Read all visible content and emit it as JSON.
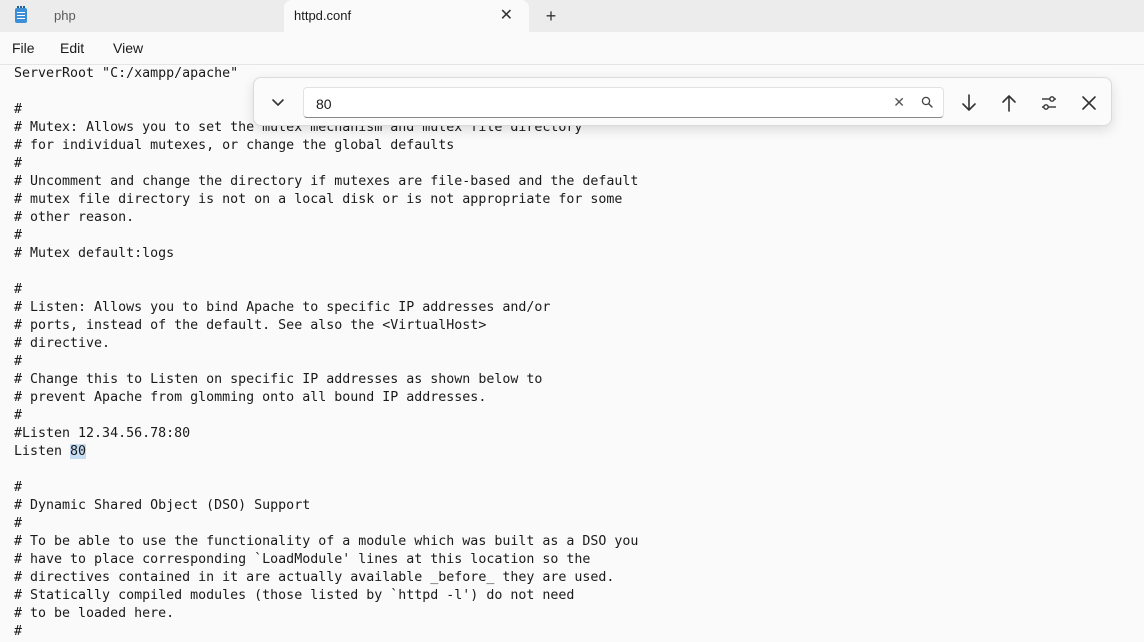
{
  "tabs": [
    {
      "label": "php",
      "active": false
    },
    {
      "label": "httpd.conf",
      "active": true
    }
  ],
  "tab_close_glyph": "✕",
  "new_tab_glyph": "+",
  "menu": [
    "File",
    "Edit",
    "View"
  ],
  "find": {
    "value": "80",
    "clear_glyph": "✕",
    "icons": [
      "chevron-down-icon",
      "search-icon",
      "arrow-down-icon",
      "arrow-up-icon",
      "settings-sliders-icon",
      "close-icon"
    ]
  },
  "editor": {
    "highlight_term": "80",
    "lines": [
      "ServerRoot \"C:/xampp/apache\"",
      "",
      "#",
      "# Mutex: Allows you to set the mutex mechanism and mutex file directory",
      "# for individual mutexes, or change the global defaults",
      "#",
      "# Uncomment and change the directory if mutexes are file-based and the default",
      "# mutex file directory is not on a local disk or is not appropriate for some",
      "# other reason.",
      "#",
      "# Mutex default:logs",
      "",
      "#",
      "# Listen: Allows you to bind Apache to specific IP addresses and/or",
      "# ports, instead of the default. See also the <VirtualHost>",
      "# directive.",
      "#",
      "# Change this to Listen on specific IP addresses as shown below to",
      "# prevent Apache from glomming onto all bound IP addresses.",
      "#",
      "#Listen 12.34.56.78:80",
      "Listen 80",
      "",
      "#",
      "# Dynamic Shared Object (DSO) Support",
      "#",
      "# To be able to use the functionality of a module which was built as a DSO you",
      "# have to place corresponding `LoadModule' lines at this location so the",
      "# directives contained in it are actually available _before_ they are used.",
      "# Statically compiled modules (those listed by `httpd -l') do not need",
      "# to be loaded here.",
      "#"
    ]
  }
}
